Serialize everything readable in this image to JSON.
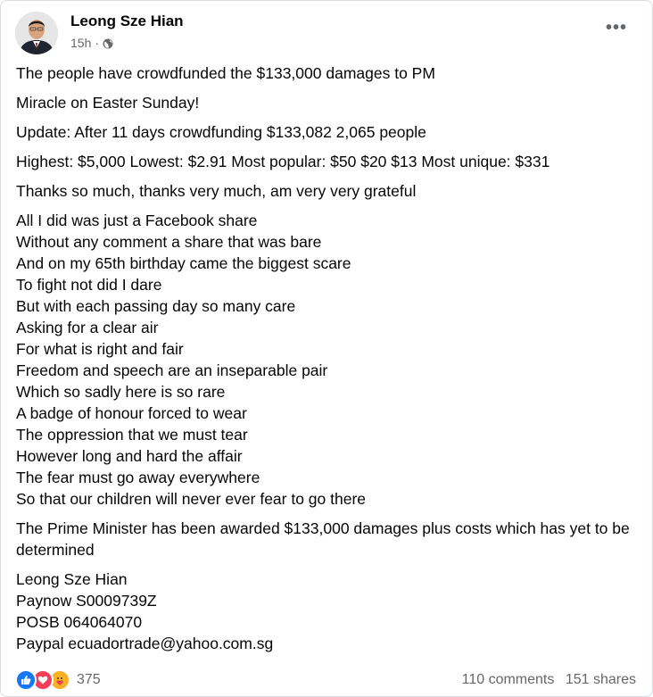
{
  "post": {
    "author": "Leong Sze Hian",
    "time": "15h",
    "visibility_icon": "globe-icon",
    "more_icon": "more-options-icon",
    "paragraphs": [
      "The people have crowdfunded the $133,000 damages to PM",
      "Miracle on Easter Sunday!",
      "Update: After 11 days crowdfunding $133,082 2,065 people",
      "Highest: $5,000 Lowest: $2.91 Most popular: $50 $20 $13 Most unique: $331",
      "Thanks so much, thanks very much, am very very grateful"
    ],
    "poem": [
      "All I did was just a Facebook share",
      "Without any comment a share that was bare",
      "And on my 65th birthday came the biggest scare",
      "To fight not did I dare",
      "But with each passing day so many care",
      "Asking for a clear air",
      "For what is right and fair",
      "Freedom and speech are an inseparable pair",
      "Which so sadly here is so rare",
      "A badge of honour forced to wear",
      "The oppression that we must tear",
      "However long and hard the affair",
      "The fear must go away everywhere",
      "So that our children will never ever fear to go there"
    ],
    "closing": "The Prime Minister has been awarded $133,000 damages plus costs which has yet to be determined",
    "signature": [
      "Leong Sze Hian",
      "Paynow S0009739Z",
      "POSB 064064070",
      "Paypal ecuadortrade@yahoo.com.sg"
    ]
  },
  "footer": {
    "reactions": [
      "like-icon",
      "love-icon",
      "care-icon"
    ],
    "reaction_count": "375",
    "comments": "110 comments",
    "shares": "151 shares"
  },
  "colors": {
    "like": "#1877f2",
    "love": "#f33e58",
    "care": "#f7b125",
    "secondary_text": "#65676b"
  }
}
